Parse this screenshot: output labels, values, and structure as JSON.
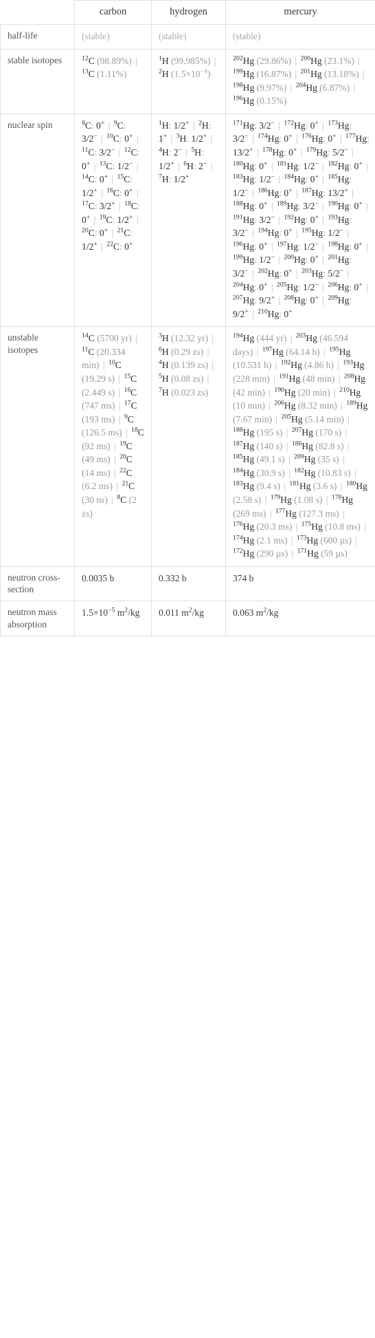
{
  "table": {
    "columns": [
      "",
      "carbon",
      "hydrogen",
      "mercury"
    ],
    "row_labels": {
      "half_life": "half-life",
      "stable_isotopes": "stable isotopes",
      "nuclear_spin": "nuclear spin",
      "unstable_isotopes": "unstable isotopes",
      "neutron_cross_section": "neutron cross-section",
      "neutron_mass_absorption": "neutron mass absorption"
    },
    "half_life": {
      "carbon": "(stable)",
      "hydrogen": "(stable)",
      "mercury": "(stable)"
    },
    "stable_isotopes": {
      "carbon": [
        {
          "mass": "12",
          "sym": "C",
          "note": "(98.89%)"
        },
        {
          "mass": "13",
          "sym": "C",
          "note": "(1.11%)"
        }
      ],
      "hydrogen": [
        {
          "mass": "1",
          "sym": "H",
          "note": "(99.985%)"
        },
        {
          "mass": "2",
          "sym": "H",
          "note": "(1.5×10⁻⁴)"
        }
      ],
      "mercury": [
        {
          "mass": "202",
          "sym": "Hg",
          "note": "(29.86%)"
        },
        {
          "mass": "200",
          "sym": "Hg",
          "note": "(23.1%)"
        },
        {
          "mass": "199",
          "sym": "Hg",
          "note": "(16.87%)"
        },
        {
          "mass": "201",
          "sym": "Hg",
          "note": "(13.18%)"
        },
        {
          "mass": "198",
          "sym": "Hg",
          "note": "(9.97%)"
        },
        {
          "mass": "204",
          "sym": "Hg",
          "note": "(6.87%)"
        },
        {
          "mass": "196",
          "sym": "Hg",
          "note": "(0.15%)"
        }
      ]
    },
    "nuclear_spin": {
      "carbon": [
        {
          "mass": "8",
          "sym": "C",
          "spin": "0+"
        },
        {
          "mass": "9",
          "sym": "C",
          "spin": "3/2−"
        },
        {
          "mass": "10",
          "sym": "C",
          "spin": "0+"
        },
        {
          "mass": "11",
          "sym": "C",
          "spin": "3/2−"
        },
        {
          "mass": "12",
          "sym": "C",
          "spin": "0+"
        },
        {
          "mass": "13",
          "sym": "C",
          "spin": "1/2−"
        },
        {
          "mass": "14",
          "sym": "C",
          "spin": "0+"
        },
        {
          "mass": "15",
          "sym": "C",
          "spin": "1/2+"
        },
        {
          "mass": "16",
          "sym": "C",
          "spin": "0+"
        },
        {
          "mass": "17",
          "sym": "C",
          "spin": "3/2+"
        },
        {
          "mass": "18",
          "sym": "C",
          "spin": "0+"
        },
        {
          "mass": "19",
          "sym": "C",
          "spin": "1/2+"
        },
        {
          "mass": "20",
          "sym": "C",
          "spin": "0+"
        },
        {
          "mass": "21",
          "sym": "C",
          "spin": "1/2+"
        },
        {
          "mass": "22",
          "sym": "C",
          "spin": "0+"
        }
      ],
      "hydrogen": [
        {
          "mass": "1",
          "sym": "H",
          "spin": "1/2+"
        },
        {
          "mass": "2",
          "sym": "H",
          "spin": "1+"
        },
        {
          "mass": "3",
          "sym": "H",
          "spin": "1/2+"
        },
        {
          "mass": "4",
          "sym": "H",
          "spin": "2−"
        },
        {
          "mass": "5",
          "sym": "H",
          "spin": "1/2+"
        },
        {
          "mass": "6",
          "sym": "H",
          "spin": "2−"
        },
        {
          "mass": "7",
          "sym": "H",
          "spin": "1/2+"
        }
      ],
      "mercury": [
        {
          "mass": "171",
          "sym": "Hg",
          "spin": "3/2−"
        },
        {
          "mass": "172",
          "sym": "Hg",
          "spin": "0+"
        },
        {
          "mass": "173",
          "sym": "Hg",
          "spin": "3/2−"
        },
        {
          "mass": "174",
          "sym": "Hg",
          "spin": "0+"
        },
        {
          "mass": "176",
          "sym": "Hg",
          "spin": "0+"
        },
        {
          "mass": "177",
          "sym": "Hg",
          "spin": "13/2+"
        },
        {
          "mass": "178",
          "sym": "Hg",
          "spin": "0+"
        },
        {
          "mass": "179",
          "sym": "Hg",
          "spin": "5/2−"
        },
        {
          "mass": "180",
          "sym": "Hg",
          "spin": "0+"
        },
        {
          "mass": "181",
          "sym": "Hg",
          "spin": "1/2−"
        },
        {
          "mass": "182",
          "sym": "Hg",
          "spin": "0+"
        },
        {
          "mass": "183",
          "sym": "Hg",
          "spin": "1/2−"
        },
        {
          "mass": "184",
          "sym": "Hg",
          "spin": "0+"
        },
        {
          "mass": "185",
          "sym": "Hg",
          "spin": "1/2−"
        },
        {
          "mass": "186",
          "sym": "Hg",
          "spin": "0+"
        },
        {
          "mass": "187",
          "sym": "Hg",
          "spin": "13/2+"
        },
        {
          "mass": "188",
          "sym": "Hg",
          "spin": "0+"
        },
        {
          "mass": "189",
          "sym": "Hg",
          "spin": "3/2−"
        },
        {
          "mass": "190",
          "sym": "Hg",
          "spin": "0+"
        },
        {
          "mass": "191",
          "sym": "Hg",
          "spin": "3/2−"
        },
        {
          "mass": "192",
          "sym": "Hg",
          "spin": "0+"
        },
        {
          "mass": "193",
          "sym": "Hg",
          "spin": "3/2−"
        },
        {
          "mass": "194",
          "sym": "Hg",
          "spin": "0+"
        },
        {
          "mass": "195",
          "sym": "Hg",
          "spin": "1/2−"
        },
        {
          "mass": "196",
          "sym": "Hg",
          "spin": "0+"
        },
        {
          "mass": "197",
          "sym": "Hg",
          "spin": "1/2−"
        },
        {
          "mass": "198",
          "sym": "Hg",
          "spin": "0+"
        },
        {
          "mass": "199",
          "sym": "Hg",
          "spin": "1/2−"
        },
        {
          "mass": "200",
          "sym": "Hg",
          "spin": "0+"
        },
        {
          "mass": "201",
          "sym": "Hg",
          "spin": "3/2−"
        },
        {
          "mass": "202",
          "sym": "Hg",
          "spin": "0+"
        },
        {
          "mass": "203",
          "sym": "Hg",
          "spin": "5/2−"
        },
        {
          "mass": "204",
          "sym": "Hg",
          "spin": "0+"
        },
        {
          "mass": "205",
          "sym": "Hg",
          "spin": "1/2−"
        },
        {
          "mass": "206",
          "sym": "Hg",
          "spin": "0+"
        },
        {
          "mass": "207",
          "sym": "Hg",
          "spin": "9/2+"
        },
        {
          "mass": "208",
          "sym": "Hg",
          "spin": "0+"
        },
        {
          "mass": "209",
          "sym": "Hg",
          "spin": "9/2+"
        },
        {
          "mass": "210",
          "sym": "Hg",
          "spin": "0+"
        }
      ]
    },
    "unstable_isotopes": {
      "carbon": [
        {
          "mass": "14",
          "sym": "C",
          "note": "(5700 yr)"
        },
        {
          "mass": "11",
          "sym": "C",
          "note": "(20.334 min)"
        },
        {
          "mass": "10",
          "sym": "C",
          "note": "(19.29 s)"
        },
        {
          "mass": "15",
          "sym": "C",
          "note": "(2.449 s)"
        },
        {
          "mass": "16",
          "sym": "C",
          "note": "(747 ms)"
        },
        {
          "mass": "17",
          "sym": "C",
          "note": "(193 ms)"
        },
        {
          "mass": "9",
          "sym": "C",
          "note": "(126.5 ms)"
        },
        {
          "mass": "18",
          "sym": "C",
          "note": "(92 ms)"
        },
        {
          "mass": "19",
          "sym": "C",
          "note": "(49 ms)"
        },
        {
          "mass": "20",
          "sym": "C",
          "note": "(14 ms)"
        },
        {
          "mass": "22",
          "sym": "C",
          "note": "(6.2 ms)"
        },
        {
          "mass": "21",
          "sym": "C",
          "note": "(30 ns)"
        },
        {
          "mass": "8",
          "sym": "C",
          "note": "(2 zs)"
        }
      ],
      "hydrogen": [
        {
          "mass": "3",
          "sym": "H",
          "note": "(12.32 yr)"
        },
        {
          "mass": "6",
          "sym": "H",
          "note": "(0.29 zs)"
        },
        {
          "mass": "4",
          "sym": "H",
          "note": "(0.139 zs)"
        },
        {
          "mass": "5",
          "sym": "H",
          "note": "(0.08 zs)"
        },
        {
          "mass": "7",
          "sym": "H",
          "note": "(0.023 zs)"
        }
      ],
      "mercury": [
        {
          "mass": "194",
          "sym": "Hg",
          "note": "(444 yr)"
        },
        {
          "mass": "203",
          "sym": "Hg",
          "note": "(46.594 days)"
        },
        {
          "mass": "197",
          "sym": "Hg",
          "note": "(64.14 h)"
        },
        {
          "mass": "195",
          "sym": "Hg",
          "note": "(10.531 h)"
        },
        {
          "mass": "192",
          "sym": "Hg",
          "note": "(4.86 h)"
        },
        {
          "mass": "193",
          "sym": "Hg",
          "note": "(228 min)"
        },
        {
          "mass": "191",
          "sym": "Hg",
          "note": "(48 min)"
        },
        {
          "mass": "208",
          "sym": "Hg",
          "note": "(42 min)"
        },
        {
          "mass": "190",
          "sym": "Hg",
          "note": "(20 min)"
        },
        {
          "mass": "210",
          "sym": "Hg",
          "note": "(10 min)"
        },
        {
          "mass": "206",
          "sym": "Hg",
          "note": "(8.32 min)"
        },
        {
          "mass": "189",
          "sym": "Hg",
          "note": "(7.67 min)"
        },
        {
          "mass": "205",
          "sym": "Hg",
          "note": "(5.14 min)"
        },
        {
          "mass": "188",
          "sym": "Hg",
          "note": "(195 s)"
        },
        {
          "mass": "207",
          "sym": "Hg",
          "note": "(170 s)"
        },
        {
          "mass": "187",
          "sym": "Hg",
          "note": "(140 s)"
        },
        {
          "mass": "186",
          "sym": "Hg",
          "note": "(82.8 s)"
        },
        {
          "mass": "185",
          "sym": "Hg",
          "note": "(49.1 s)"
        },
        {
          "mass": "209",
          "sym": "Hg",
          "note": "(35 s)"
        },
        {
          "mass": "184",
          "sym": "Hg",
          "note": "(30.9 s)"
        },
        {
          "mass": "182",
          "sym": "Hg",
          "note": "(10.83 s)"
        },
        {
          "mass": "183",
          "sym": "Hg",
          "note": "(9.4 s)"
        },
        {
          "mass": "181",
          "sym": "Hg",
          "note": "(3.6 s)"
        },
        {
          "mass": "180",
          "sym": "Hg",
          "note": "(2.58 s)"
        },
        {
          "mass": "179",
          "sym": "Hg",
          "note": "(1.08 s)"
        },
        {
          "mass": "178",
          "sym": "Hg",
          "note": "(269 ms)"
        },
        {
          "mass": "177",
          "sym": "Hg",
          "note": "(127.3 ms)"
        },
        {
          "mass": "176",
          "sym": "Hg",
          "note": "(20.3 ms)"
        },
        {
          "mass": "175",
          "sym": "Hg",
          "note": "(10.8 ms)"
        },
        {
          "mass": "174",
          "sym": "Hg",
          "note": "(2.1 ms)"
        },
        {
          "mass": "173",
          "sym": "Hg",
          "note": "(600 µs)"
        },
        {
          "mass": "172",
          "sym": "Hg",
          "note": "(290 µs)"
        },
        {
          "mass": "171",
          "sym": "Hg",
          "note": "(59 µs)"
        }
      ]
    },
    "neutron_cross_section": {
      "carbon": "0.0035 b",
      "hydrogen": "0.332 b",
      "mercury": "374 b"
    },
    "neutron_mass_absorption": {
      "carbon": "1.5×10⁻⁵ m²/kg",
      "hydrogen": "0.011 m²/kg",
      "mercury": "0.063 m²/kg"
    }
  }
}
